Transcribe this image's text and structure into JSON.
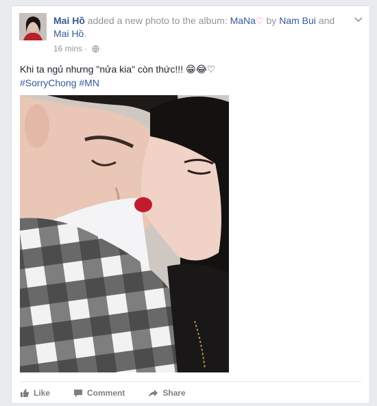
{
  "post": {
    "author_name": "Mai Hồ",
    "action_text": " added a new photo to the album: ",
    "album_name": "MaNa",
    "heart_glyph": "♡",
    "by_text": " by ",
    "co_author_1": "Nam Bui",
    "and_text": " and ",
    "co_author_2": "Mai Hồ",
    "end_period": ".",
    "timestamp": "16 mins",
    "separator": " · ",
    "body_text": "Khi ta ngủ nhưng \"nửa kia\" còn thức!!! 😁😂♡",
    "hashtags": "#SorryChong #MN"
  },
  "actions": {
    "like_label": "Like",
    "comment_label": "Comment",
    "share_label": "Share"
  },
  "icons": {
    "options": "chevron-down-icon",
    "privacy": "globe-icon",
    "like": "thumbs-up-icon",
    "comment": "comment-icon",
    "share": "share-arrow-icon"
  },
  "colors": {
    "link": "#365899",
    "muted": "#90949c",
    "heart": "#f05a6a",
    "action": "#7f7f7f"
  }
}
